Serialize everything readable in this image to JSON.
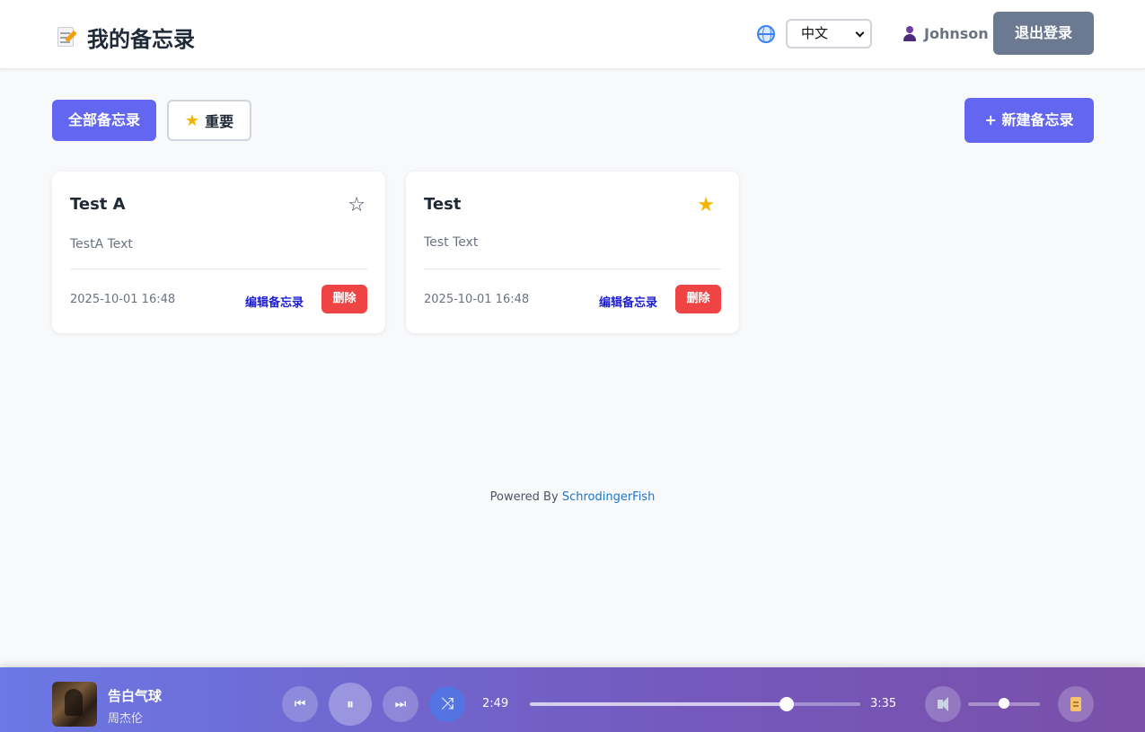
{
  "app": {
    "title": "我的备忘录",
    "language": "中文",
    "username": "Johnson",
    "logout_label": "退出登录"
  },
  "filters": {
    "all_label": "全部备忘录",
    "important_label": "重要",
    "new_label": "+ 新建备忘录"
  },
  "memos": [
    {
      "title": "Test A",
      "text": "TestA Text",
      "date": "2025-10-01 16:48",
      "important": false,
      "star_glyph": "☆",
      "edit_label": "编辑备忘录",
      "delete_label": "删除"
    },
    {
      "title": "Test",
      "text": "Test Text",
      "date": "2025-10-01 16:48",
      "important": true,
      "star_glyph": "★",
      "edit_label": "编辑备忘录",
      "delete_label": "删除"
    }
  ],
  "footer": {
    "prefix": "Powered By ",
    "link": "SchrodingerFish"
  },
  "player": {
    "song_title": "告白气球",
    "artist": "周杰伦",
    "current_time": "2:49",
    "total_time": "3:35",
    "progress_fraction": 0.777,
    "volume_fraction": 0.5,
    "icons": {
      "prev": "⏮",
      "pause": "⏸",
      "next": "⏭",
      "shuffle": "⤨"
    }
  },
  "colors": {
    "accent": "#6366f1",
    "danger": "#ef4444",
    "logout": "#6b7a90",
    "star": "#f4b400"
  }
}
